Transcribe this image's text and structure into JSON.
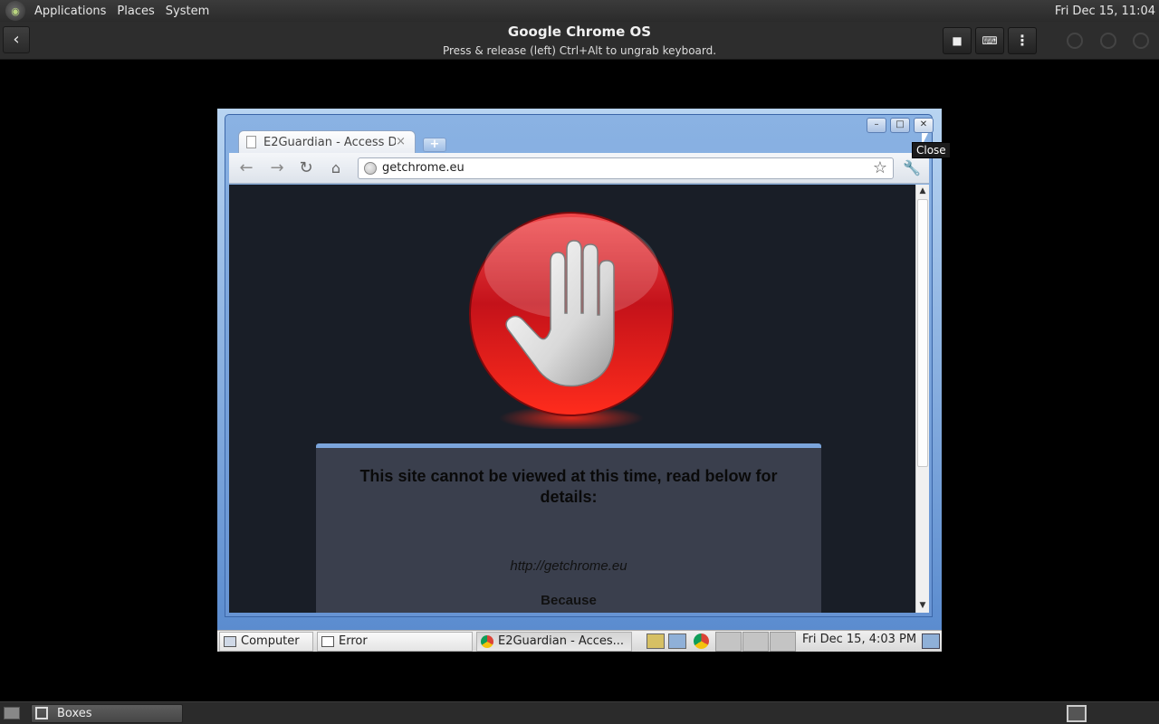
{
  "host_top": {
    "menus": [
      "Applications",
      "Places",
      "System"
    ],
    "clock": "Fri Dec 15, 11:04"
  },
  "boxes": {
    "title": "Google Chrome OS",
    "hint": "Press & release (left) Ctrl+Alt to ungrab keyboard."
  },
  "browser": {
    "tab_title": "E2Guardian - Access D",
    "tab_close": "×",
    "new_tab": "+",
    "url": "getchrome.eu",
    "tooltip": "Close"
  },
  "block_page": {
    "headline": "This site cannot be viewed at this time, read below for details:",
    "url": "http://getchrome.eu",
    "because": "Because"
  },
  "guest_taskbar": {
    "items": [
      {
        "label": "Computer",
        "icon": "computer-icon"
      },
      {
        "label": "Error",
        "icon": "window-icon"
      },
      {
        "label": "E2Guardian - Acces...",
        "icon": "chrome-icon"
      }
    ],
    "clock": "Fri Dec 15,  4:03 PM"
  },
  "host_bottom": {
    "task": "Boxes"
  },
  "colors": {
    "stop_red": "#e0141c",
    "panel_bg": "#3a3f4d",
    "page_bg": "#191e27"
  }
}
